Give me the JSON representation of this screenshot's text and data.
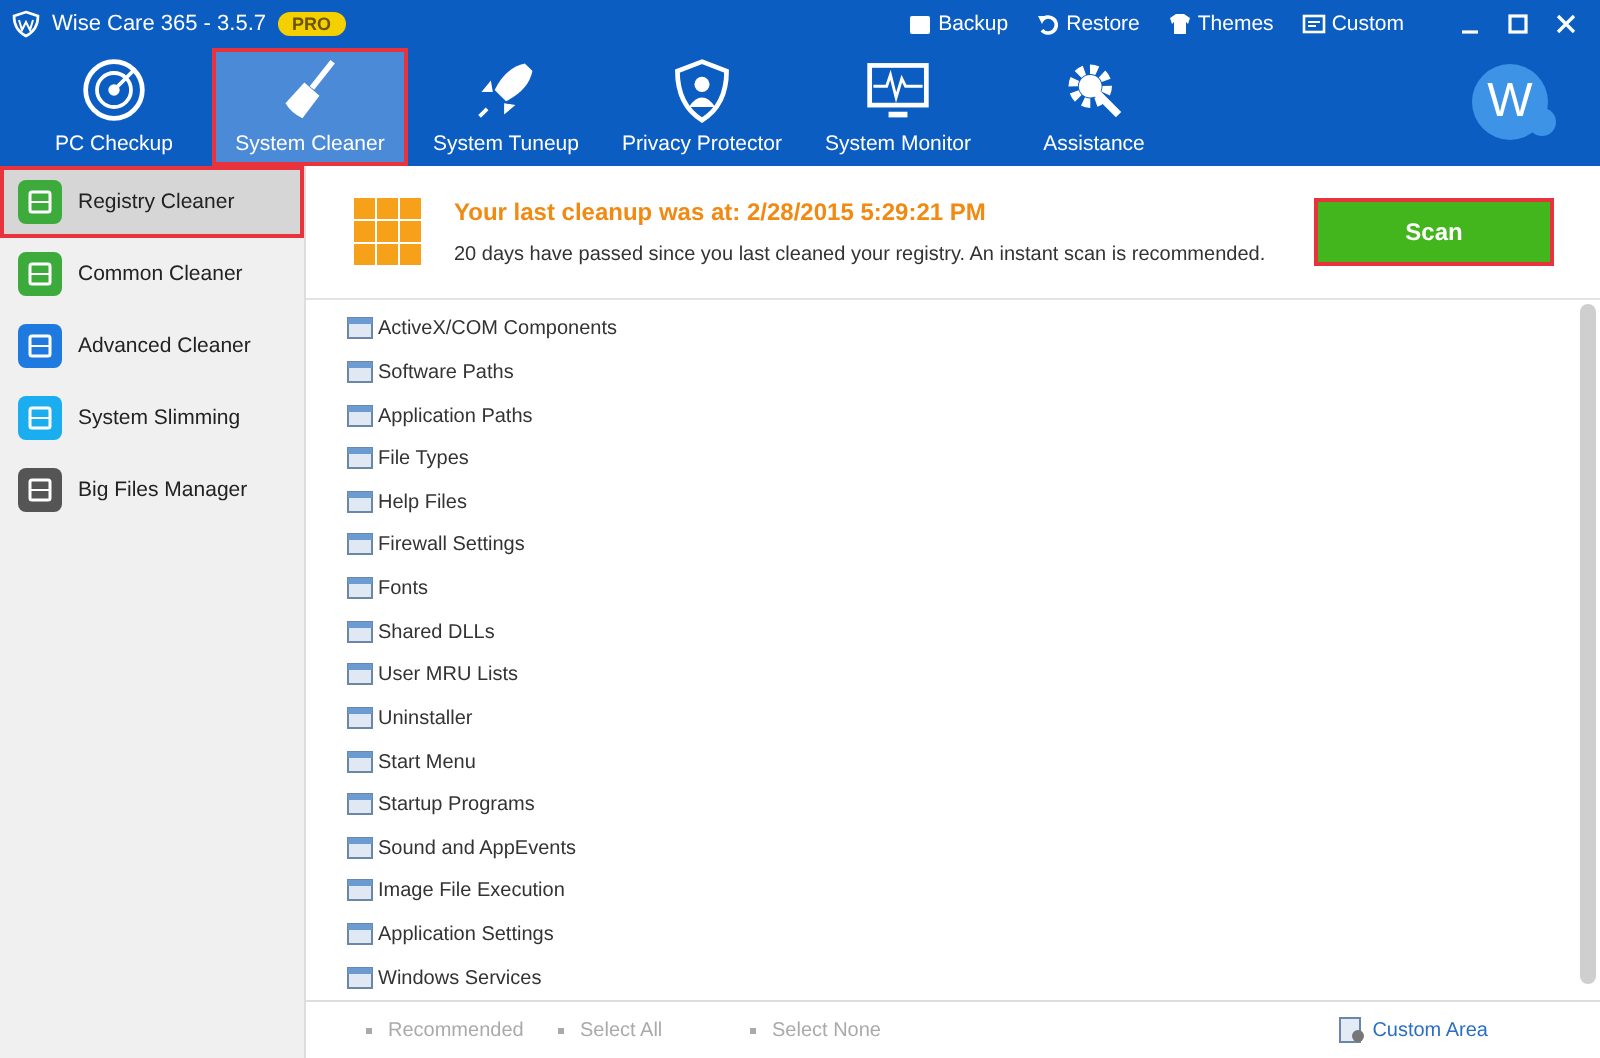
{
  "window": {
    "title": "Wise Care 365 - 3.5.7",
    "badge": "PRO"
  },
  "top_links": [
    {
      "label": "Backup",
      "kind": "backup"
    },
    {
      "label": "Restore",
      "kind": "restore"
    },
    {
      "label": "Themes",
      "kind": "themes"
    },
    {
      "label": "Custom",
      "kind": "custom"
    }
  ],
  "tabs": [
    {
      "label": "PC Checkup",
      "kind": "radar",
      "selected": false,
      "highlighted": false
    },
    {
      "label": "System Cleaner",
      "kind": "broom",
      "selected": true,
      "highlighted": true
    },
    {
      "label": "System Tuneup",
      "kind": "rocket",
      "selected": false,
      "highlighted": false
    },
    {
      "label": "Privacy Protector",
      "kind": "shield",
      "selected": false,
      "highlighted": false
    },
    {
      "label": "System Monitor",
      "kind": "monitor",
      "selected": false,
      "highlighted": false
    },
    {
      "label": "Assistance",
      "kind": "gear",
      "selected": false,
      "highlighted": false
    }
  ],
  "avatar": {
    "letter": "W"
  },
  "sidebar": {
    "items": [
      {
        "label": "Registry Cleaner",
        "color": "#3cab3c",
        "selected": true,
        "highlighted": true
      },
      {
        "label": "Common Cleaner",
        "color": "#3cab3c",
        "selected": false,
        "highlighted": false
      },
      {
        "label": "Advanced Cleaner",
        "color": "#1f7ae0",
        "selected": false,
        "highlighted": false
      },
      {
        "label": "System Slimming",
        "color": "#1aaef0",
        "selected": false,
        "highlighted": false
      },
      {
        "label": "Big Files Manager",
        "color": "#555555",
        "selected": false,
        "highlighted": false
      }
    ]
  },
  "header": {
    "title": "Your last cleanup was at: 2/28/2015 5:29:21 PM",
    "message": "20 days have passed since you last cleaned your registry. An instant scan is recommended.",
    "scan_button": {
      "label": "Scan",
      "highlighted": true
    }
  },
  "registry_items": [
    "ActiveX/COM Components",
    "Software Paths",
    "Application Paths",
    "File Types",
    "Help Files",
    "Firewall Settings",
    "Fonts",
    "Shared DLLs",
    "User MRU Lists",
    "Uninstaller",
    "Start Menu",
    "Startup Programs",
    "Sound and AppEvents",
    "Image File Execution",
    "Application Settings",
    "Windows Services"
  ],
  "footer": {
    "links": [
      "Recommended",
      "Select All",
      "Select None"
    ],
    "custom_area": "Custom Area"
  }
}
